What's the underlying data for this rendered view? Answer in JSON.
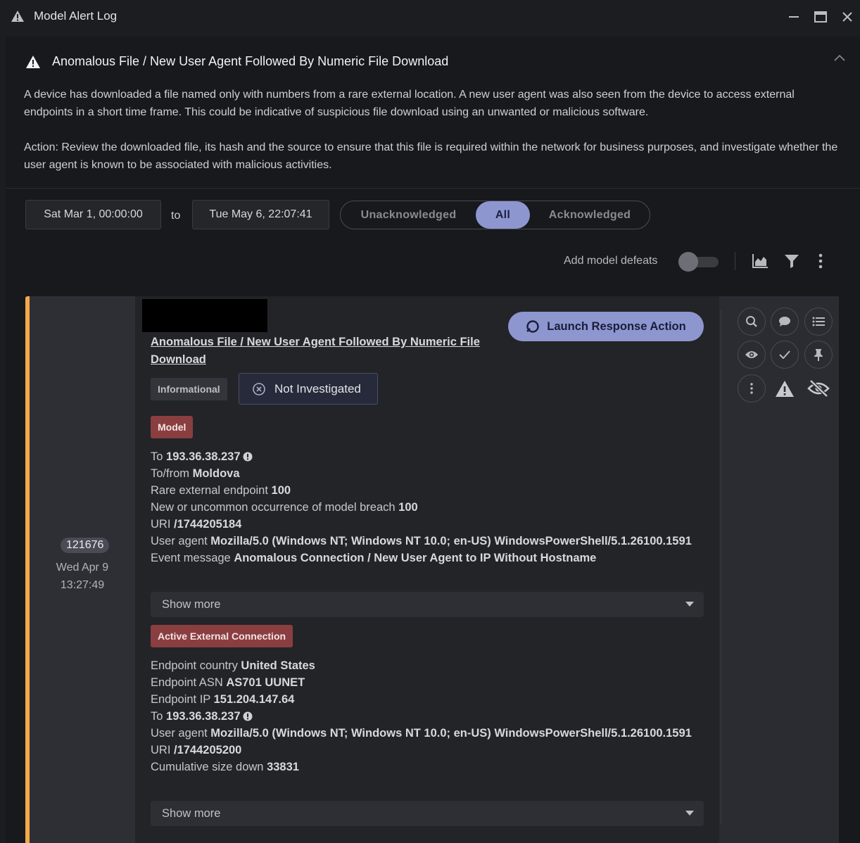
{
  "window": {
    "title": "Model Alert Log",
    "warning_icon": "warning-triangle-icon",
    "minimize_icon": "minimize-icon",
    "maximize_icon": "maximize-icon",
    "close_icon": "close-icon"
  },
  "model": {
    "title": "Anomalous File / New User Agent Followed By Numeric File Download",
    "description": "A device has downloaded a file named only with numbers from a rare external location. A new user agent was also seen from the device to access external endpoints in a short time frame. This could be indicative of suspicious file download using an unwanted or malicious software.",
    "action": "Action: Review the downloaded file, its hash and the source to ensure that this file is required within the network for business purposes, and investigate whether the user agent is known to be associated with malicious activities."
  },
  "filters": {
    "from_date": "Sat Mar 1, 00:00:00",
    "to_label": "to",
    "to_date": "Tue May 6, 22:07:41",
    "segments": [
      "Unacknowledged",
      "All",
      "Acknowledged"
    ],
    "active_segment": "All",
    "add_model_defeats_label": "Add model defeats",
    "add_model_defeats_on": false
  },
  "alert": {
    "pbid": "121676",
    "date": "Wed Apr 9",
    "time": "13:27:49",
    "accent_color": "#f2a94b",
    "title": "Anomalous File / New User Agent Followed By Numeric File Download",
    "launch_label": "Launch Response Action",
    "category": "Informational",
    "status": "Not Investigated",
    "model_tag": "Model",
    "model_details": [
      {
        "label": "To ",
        "value": "193.36.38.237",
        "info": true
      },
      {
        "label": "To/from ",
        "value": "Moldova"
      },
      {
        "label": "Rare external endpoint ",
        "value": "100"
      },
      {
        "label": "New or uncommon occurrence of model breach ",
        "value": "100"
      },
      {
        "label": "URI ",
        "value": "/1744205184"
      },
      {
        "label": "User agent ",
        "value": "Mozilla/5.0 (Windows NT; Windows NT 10.0; en-US) WindowsPowerShell/5.1.26100.1591"
      },
      {
        "label": "Event message ",
        "value": "Anomalous Connection / New User Agent to IP Without Hostname"
      }
    ],
    "show_more": "Show more",
    "connection_tag": "Active External Connection",
    "connection_details": [
      {
        "label": "Endpoint country ",
        "value": "United States"
      },
      {
        "label": "Endpoint ASN ",
        "value": "AS701 UUNET"
      },
      {
        "label": "Endpoint IP ",
        "value": "151.204.147.64"
      },
      {
        "label": "To ",
        "value": "193.36.38.237",
        "info": true
      },
      {
        "label": "User agent ",
        "value": "Mozilla/5.0 (Windows NT; Windows NT 10.0; en-US) WindowsPowerShell/5.1.26100.1591"
      },
      {
        "label": "URI ",
        "value": "/1744205200"
      },
      {
        "label": "Cumulative size down ",
        "value": "33831"
      }
    ],
    "show_more_2": "Show more"
  },
  "colors": {
    "accent_purple": "#8d96cf",
    "tag_red": "#8a3e40",
    "warning_orange": "#f2a94b"
  }
}
